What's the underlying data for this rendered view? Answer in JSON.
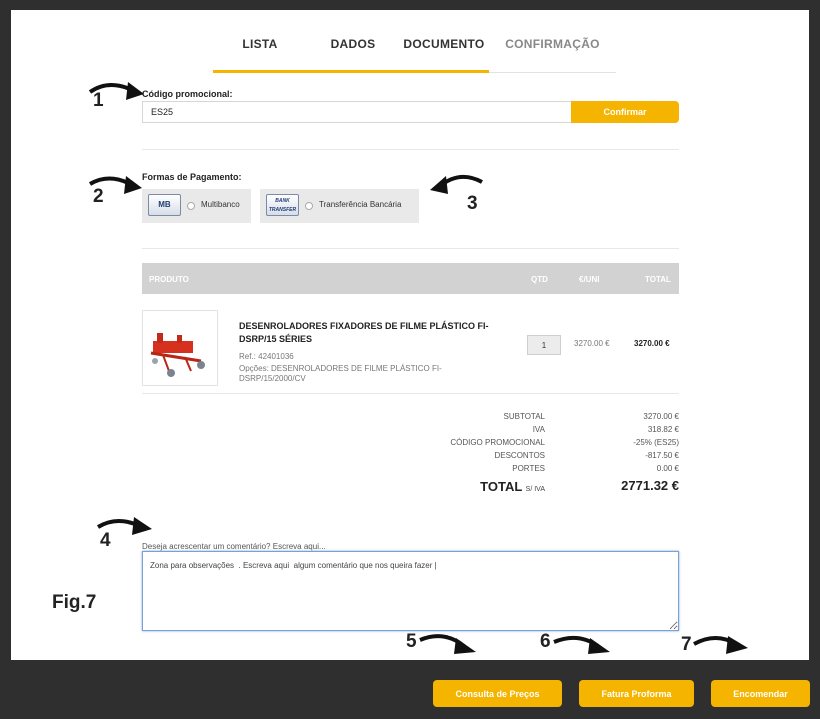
{
  "tabs": [
    {
      "label": "LISTA"
    },
    {
      "label": "DADOS"
    },
    {
      "label": "DOCUMENTO"
    },
    {
      "label": "CONFIRMAÇÃO"
    }
  ],
  "promo": {
    "label": "Código promocional:",
    "value": "ES25",
    "button": "Confirmar"
  },
  "payment": {
    "label": "Formas de Pagamento:",
    "options": [
      {
        "logo": "MB",
        "label": "Multibanco"
      },
      {
        "logo": "BANK TRANSFER",
        "label": "Transferência Bancária"
      }
    ]
  },
  "table": {
    "headers": {
      "product": "PRODUTO",
      "qty": "QTD",
      "unit": "€/UNI",
      "total": "TOTAL"
    },
    "item": {
      "title": "DESENROLADORES FIXADORES DE FILME PLÁSTICO FI-DSRP/15 SÉRIES",
      "ref": "Ref.: 42401036",
      "options": "Opções: DESENROLADORES DE FILME PLÁSTICO FI-DSRP/15/2000/CV",
      "qty": "1",
      "unit_price": "3270.00 €",
      "total": "3270.00 €"
    }
  },
  "summary": {
    "rows": [
      {
        "label": "SUBTOTAL",
        "value": "3270.00 €"
      },
      {
        "label": "IVA",
        "value": "318.82 €"
      },
      {
        "label": "CÓDIGO PROMOCIONAL",
        "value": "-25% (ES25)"
      },
      {
        "label": "DESCONTOS",
        "value": "-817.50 €"
      },
      {
        "label": "PORTES",
        "value": "0.00 €"
      }
    ],
    "total_label": "TOTAL",
    "total_suffix": "S/ IVA",
    "total_value": "2771.32 €"
  },
  "comment": {
    "label": "Deseja acrescentar um comentário? Escreva aqui...",
    "value": "Zona para observações  . Escreva aqui  algum comentário que nos queira fazer |"
  },
  "annotations": {
    "fig": "Fig.7",
    "numbers": [
      "1",
      "2",
      "3",
      "4",
      "5",
      "6",
      "7"
    ]
  },
  "footer": {
    "buttons": [
      "Consulta de Preços",
      "Fatura Proforma",
      "Encomendar"
    ]
  },
  "colors": {
    "accent": "#f5b400",
    "footer_bg": "#2f2f2f",
    "table_header": "#d2d2d2"
  }
}
